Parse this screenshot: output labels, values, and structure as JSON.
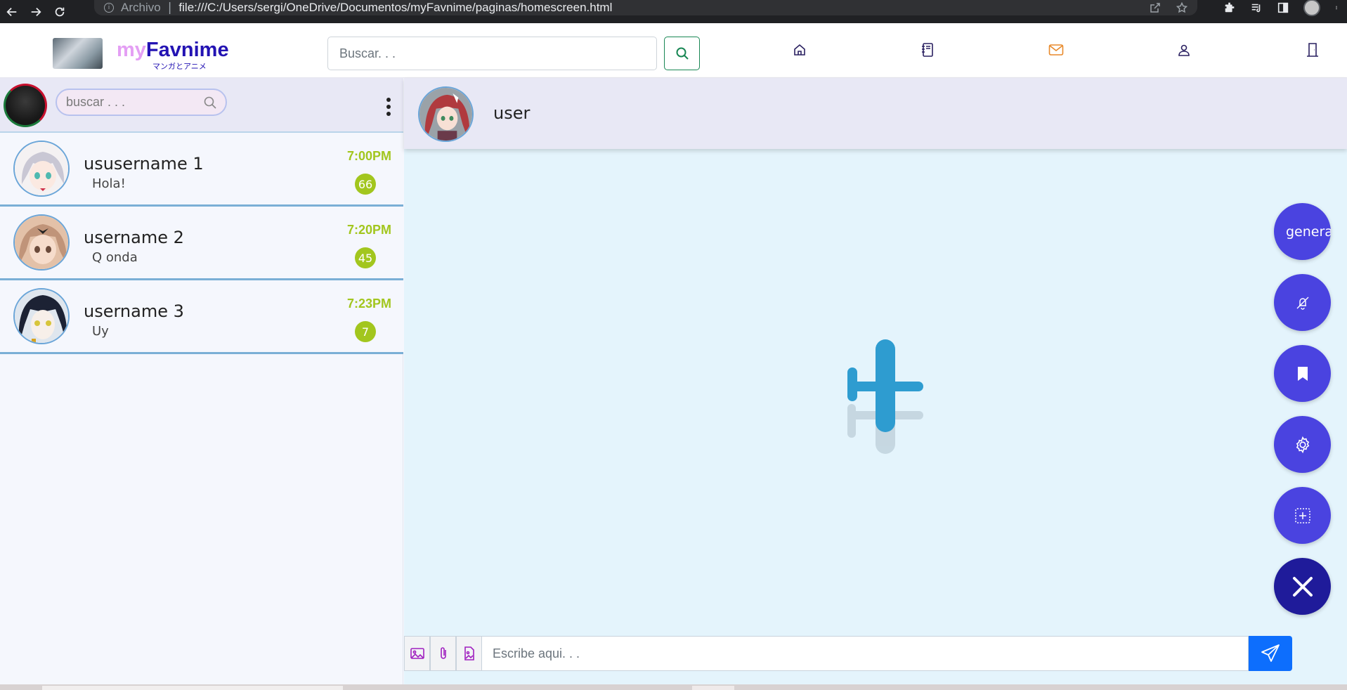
{
  "browser": {
    "scheme_label": "Archivo",
    "url": "file:///C:/Users/sergi/OneDrive/Documentos/myFavnime/paginas/homescreen.html"
  },
  "header": {
    "logo_my": "my",
    "logo_fav": "Favnime",
    "logo_sub": "マンガとアニメ",
    "search_placeholder": "Buscar. . .",
    "nav_icons": [
      "home-icon",
      "journal-icon",
      "envelope-icon",
      "person-icon",
      "door-icon"
    ],
    "active_color": "#e8892a"
  },
  "sidebar": {
    "search_placeholder": "buscar . . .",
    "chats": [
      {
        "name": "ususername 1",
        "message": "Hola!",
        "time": "7:00PM",
        "unread": "66"
      },
      {
        "name": "username 2",
        "message": "Q onda",
        "time": "7:20PM",
        "unread": "45"
      },
      {
        "name": "username 3",
        "message": "Uy",
        "time": "7:23PM",
        "unread": "7"
      }
    ]
  },
  "conversation": {
    "contact_name": "user",
    "fab_generate_label": "generar",
    "composer_placeholder": "Escribe aqui. . ."
  },
  "colors": {
    "accent_green": "#a2c61e",
    "fab_blue": "#4a43e0",
    "fab_close": "#1f1b9a",
    "send_blue": "#0d6efd",
    "logo_purple": "#2313b3"
  }
}
